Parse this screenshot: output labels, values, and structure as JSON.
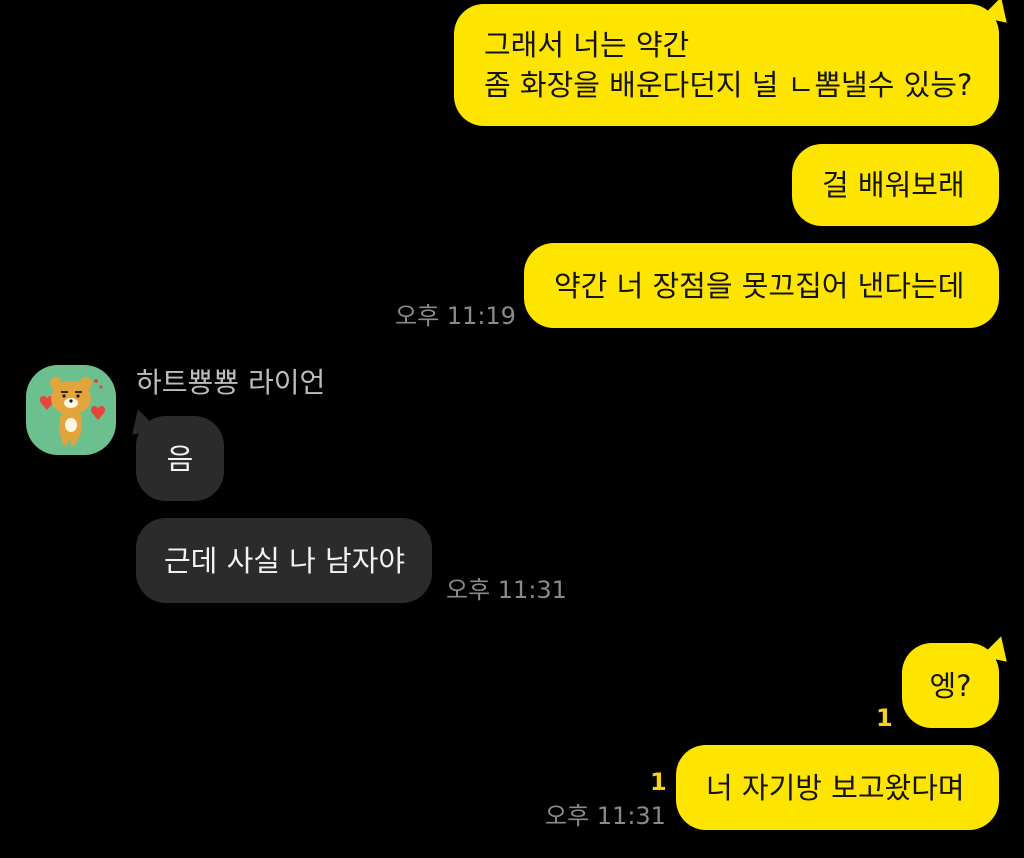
{
  "messages_top": {
    "m1_line1": "그래서 너는 약간",
    "m1_line2": "좀 화장을 배운다던지 널 ㄴ뽐낼수 있능?",
    "m2": "걸 배워보래",
    "m3": "약간 너 장점을 못끄집어 낸다는데",
    "time1": "오후 11:19"
  },
  "incoming": {
    "sender_name": "하트뿅뿅 라이언",
    "avatar_icon": "ryan-character-icon",
    "m1": "음",
    "m2": "근데 사실 나 남자야",
    "time": "오후 11:31"
  },
  "messages_bottom": {
    "m1": "엥?",
    "m1_unread": "1",
    "m2": "너 자기방 보고왔다며",
    "m2_unread": "1",
    "time": "오후 11:31"
  },
  "colors": {
    "my_bubble": "#FEE500",
    "their_bubble": "#2B2B2B",
    "background": "#000000",
    "unread": "#F6D21A"
  }
}
